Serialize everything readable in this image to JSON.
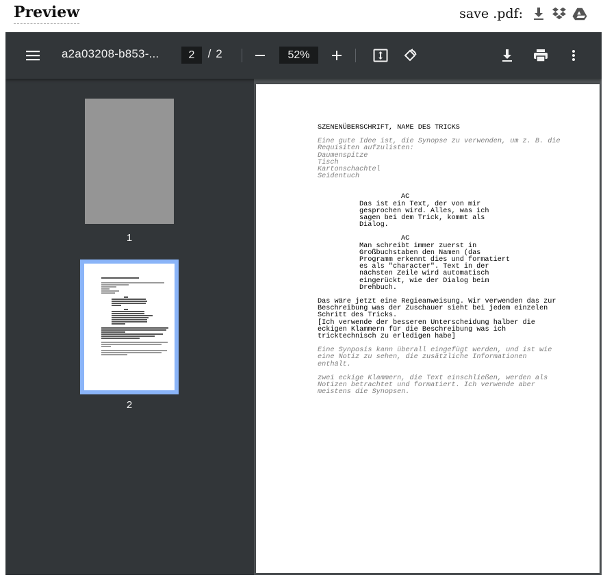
{
  "header": {
    "title": "Preview",
    "save_label": "save .pdf:",
    "icons": [
      "download-icon",
      "dropbox-icon",
      "google-drive-icon"
    ]
  },
  "toolbar": {
    "filename": "a2a03208-b853-...",
    "current_page": "2",
    "page_separator": "/",
    "total_pages": "2",
    "zoom": "52%",
    "icons": [
      "menu-icon",
      "zoom-out-icon",
      "zoom-in-icon",
      "fit-page-icon",
      "rotate-icon",
      "download-icon",
      "print-icon",
      "more-options-icon"
    ]
  },
  "sidebar": {
    "thumbnails": [
      {
        "number": "1",
        "selected": false
      },
      {
        "number": "2",
        "selected": true
      }
    ]
  },
  "colors": {
    "toolbar_bg": "#323639",
    "viewer_bg": "#525659",
    "selection": "#8ab4f8",
    "synopsis_text": "#7e7e7e"
  },
  "document": {
    "scene_heading": "SZENENÜBERSCHRIFT, NAME DES TRICKS",
    "synopsis1": [
      "Eine gute Idee ist, die Synopse zu verwenden, um z. B. die",
      "Requisiten aufzulisten:",
      "Daumenspitze",
      "Tisch",
      "Kartonschachtel",
      "Seidentuch"
    ],
    "character1": "AC",
    "dialogue1": [
      "Das ist ein Text, der von mir",
      "gesprochen wird. Alles, was ich",
      "sagen bei dem Trick, kommt als",
      "Dialog."
    ],
    "character2": "AC",
    "dialogue2": [
      "Man schreibt immer zuerst in",
      "Großbuchstaben den Namen (das",
      "Programm erkennt dies und formatiert",
      "es als \"character\". Text in der",
      "nächsten Zeile wird automatisch",
      "eingerückt, wie der Dialog beim",
      "Drehbuch."
    ],
    "action": [
      "Das wäre jetzt eine Regieanweisung. Wir verwenden das zur",
      "Beschreibung was der Zuschauer sieht bei jedem einzelen",
      "Schritt des Tricks.",
      "[Ich verwende der besseren Unterscheidung halber die",
      "eckigen Klammern für die Beschreibung was ich",
      "tricktechnisch zu erledigen habe]"
    ],
    "synopsis2": [
      "Eine Synposis kann überall eingefügt werden, und ist wie",
      "eine Notiz zu sehen, die zusätzliche Informationen",
      "enthält."
    ],
    "synopsis3": [
      "zwei eckige Klammern, die Text einschließen, werden als",
      "Notizen betrachtet und formatiert. Ich verwende aber",
      "meistens die Synopsen."
    ]
  }
}
